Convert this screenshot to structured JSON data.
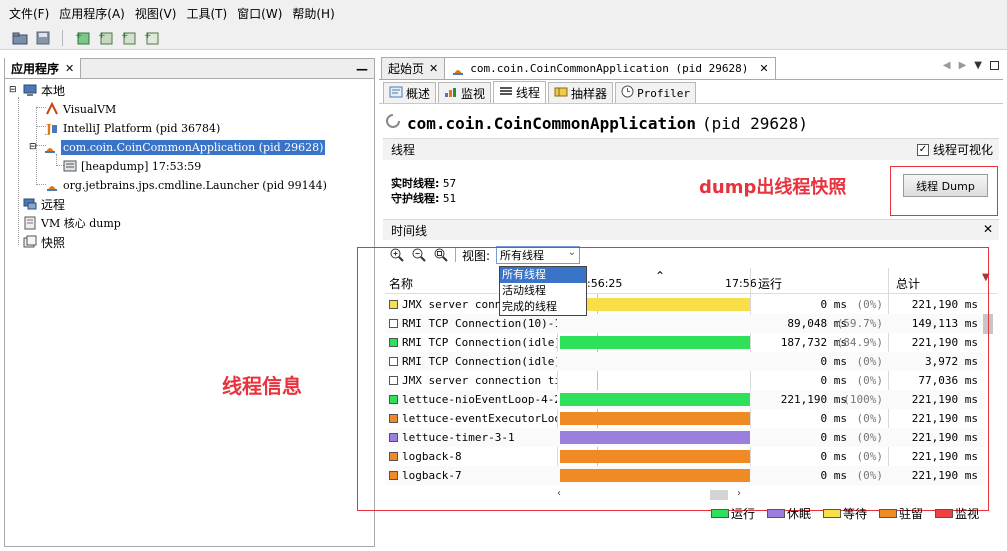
{
  "menu": [
    "文件(F)",
    "应用程序(A)",
    "视图(V)",
    "工具(T)",
    "窗口(W)",
    "帮助(H)"
  ],
  "toolbar_icons": [
    "open-icon",
    "save-icon",
    "add-jmx-icon",
    "add-core-dump-icon",
    "add-snapshot-icon",
    "compare-snapshot-icon"
  ],
  "left_panel": {
    "tab_label": "应用程序",
    "close": "✕",
    "minimize": "—",
    "tree": {
      "local": "本地",
      "visualvm": "VisualVM",
      "intellij": "IntelliJ Platform (pid 36784)",
      "app_selected": "com.coin.CoinCommonApplication (pid 29628)",
      "heapdump": "[heapdump] 17:53:59",
      "launcher": "org.jetbrains.jps.cmdline.Launcher (pid 99144)",
      "remote": "远程",
      "vm_core_dump": "VM 核心 dump",
      "snapshots": "快照"
    }
  },
  "doc_tabs": {
    "start_page": "起始页",
    "app_tab": "com.coin.CoinCommonApplication (pid 29628)",
    "close": "✕"
  },
  "sub_tabs": [
    "概述",
    "监视",
    "线程",
    "抽样器",
    "Profiler"
  ],
  "app_title": {
    "name": "com.coin.CoinCommonApplication",
    "pid": "(pid 29628)"
  },
  "threads_section": {
    "header": "线程",
    "viz_label": "线程可视化",
    "live_label": "实时线程:",
    "live_value": "57",
    "daemon_label": "守护线程:",
    "daemon_value": "51",
    "dump_button": "线程 Dump",
    "annotation_dump": "dump出线程快照"
  },
  "timeline": {
    "header": "时间线",
    "close": "✕",
    "view_label": "视图:",
    "view_selected": "所有线程",
    "view_options": [
      "所有线程",
      "活动线程",
      "完成的线程"
    ],
    "col_name": "名称",
    "time_tick_1": "7:56:25",
    "time_tick_2": "17:56",
    "col_running": "运行",
    "col_total": "总计",
    "annotation_threads": "线程信息"
  },
  "colors": {
    "running": "#2ee05a",
    "sleeping": "#9b7fdd",
    "waiting": "#f8df4a",
    "parked": "#f08a24",
    "monitor": "#f24040",
    "annotation": "#e8323c"
  },
  "threads": [
    {
      "name": "JMX server conne…",
      "state": "waiting",
      "bar": "waiting",
      "running": "0 ms",
      "pct": "(0%)",
      "total": "221,190 ms"
    },
    {
      "name": "RMI TCP Connection(10)-192.…",
      "state": "none",
      "bar": "none",
      "running": "89,048 ms",
      "pct": "(59.7%)",
      "total": "149,113 ms"
    },
    {
      "name": "RMI TCP Connection(idle)",
      "state": "running",
      "bar": "running",
      "running": "187,732 ms",
      "pct": "(84.9%)",
      "total": "221,190 ms"
    },
    {
      "name": "RMI TCP Connection(idle)",
      "state": "none",
      "bar": "none",
      "running": "0 ms",
      "pct": "(0%)",
      "total": "3,972 ms"
    },
    {
      "name": "JMX server connection timeo…",
      "state": "none",
      "bar": "none",
      "running": "0 ms",
      "pct": "(0%)",
      "total": "77,036 ms"
    },
    {
      "name": "lettuce-nioEventLoop-4-2",
      "state": "running",
      "bar": "running",
      "running": "221,190 ms",
      "pct": "(100%)",
      "total": "221,190 ms"
    },
    {
      "name": "lettuce-eventExecutorLoop-1…",
      "state": "parked",
      "bar": "parked",
      "running": "0 ms",
      "pct": "(0%)",
      "total": "221,190 ms"
    },
    {
      "name": "lettuce-timer-3-1",
      "state": "sleeping",
      "bar": "sleeping",
      "running": "0 ms",
      "pct": "(0%)",
      "total": "221,190 ms"
    },
    {
      "name": "logback-8",
      "state": "parked",
      "bar": "parked",
      "running": "0 ms",
      "pct": "(0%)",
      "total": "221,190 ms"
    },
    {
      "name": "logback-7",
      "state": "parked",
      "bar": "parked",
      "running": "0 ms",
      "pct": "(0%)",
      "total": "221,190 ms"
    }
  ],
  "legend": [
    "运行",
    "休眠",
    "等待",
    "驻留",
    "监视"
  ]
}
